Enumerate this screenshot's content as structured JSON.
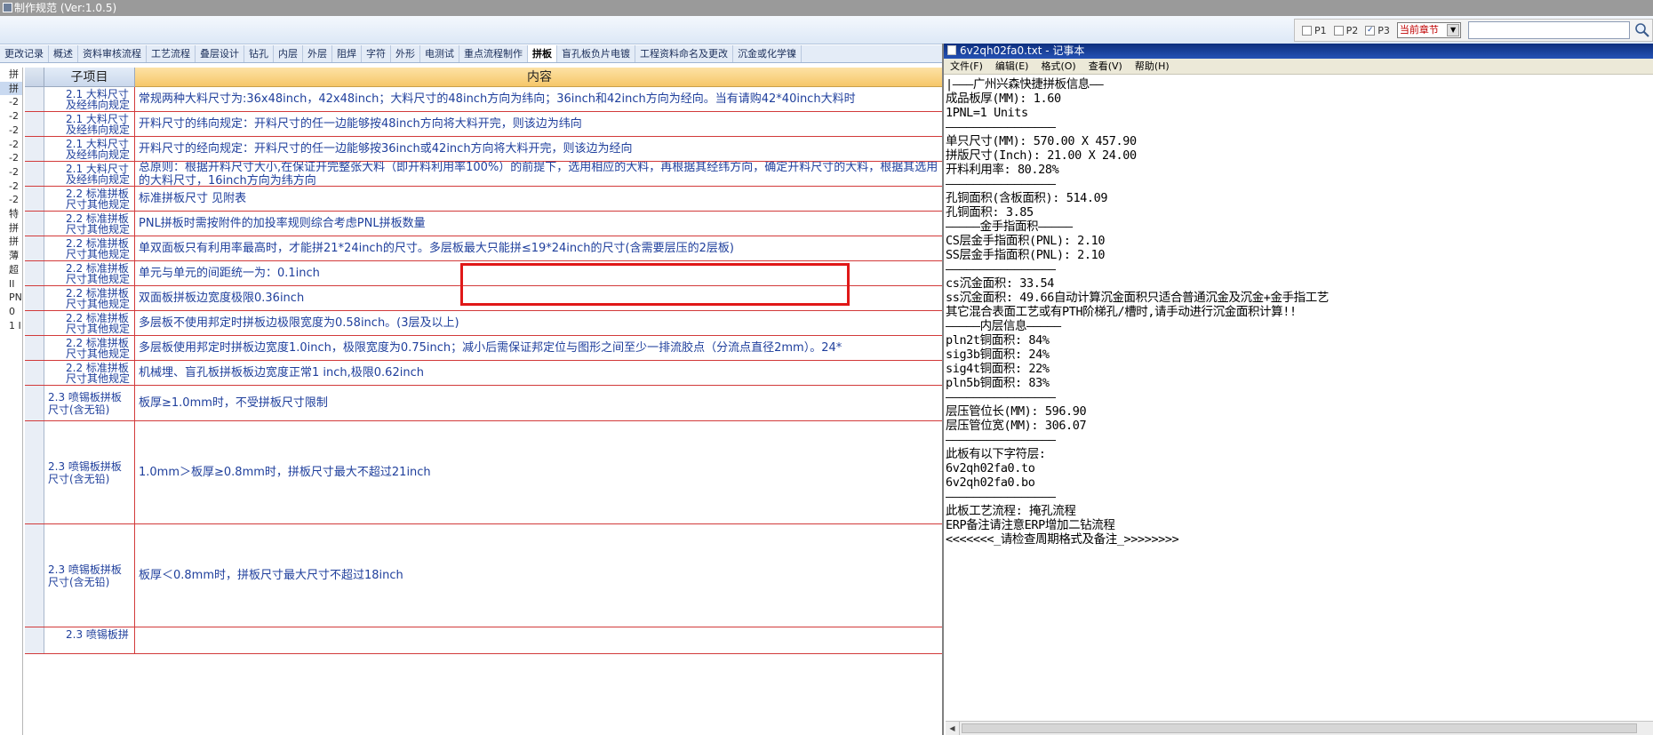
{
  "app": {
    "title": "制作规范 (Ver:1.0.5)"
  },
  "toolbar": {
    "pages": [
      {
        "label": "P1",
        "checked": false
      },
      {
        "label": "P2",
        "checked": false
      },
      {
        "label": "P3",
        "checked": true
      }
    ],
    "chapter_value": "当前章节",
    "search_value": ""
  },
  "tabs": [
    {
      "label": "更改记录",
      "active": false
    },
    {
      "label": "概述",
      "active": false
    },
    {
      "label": "资料审核流程",
      "active": false
    },
    {
      "label": "工艺流程",
      "active": false
    },
    {
      "label": "叠层设计",
      "active": false
    },
    {
      "label": "钻孔",
      "active": false
    },
    {
      "label": "内层",
      "active": false
    },
    {
      "label": "外层",
      "active": false
    },
    {
      "label": "阻焊",
      "active": false
    },
    {
      "label": "字符",
      "active": false
    },
    {
      "label": "外形",
      "active": false
    },
    {
      "label": "电测试",
      "active": false
    },
    {
      "label": "重点流程制作",
      "active": false
    },
    {
      "label": "拼板",
      "active": true
    },
    {
      "label": "盲孔板负片电镀",
      "active": false
    },
    {
      "label": "工程资料命名及更改",
      "active": false
    },
    {
      "label": "沉金或化学镍",
      "active": false
    }
  ],
  "left_tree": [
    "拼",
    "拼",
    "-2",
    "-2",
    "-2",
    "-2",
    "-2",
    "-2",
    "-2",
    "-2",
    "特",
    "拼",
    "拼",
    "薄",
    "超",
    "II",
    "PN",
    "0 ",
    "1 I"
  ],
  "grid": {
    "headers": {
      "sub": "子项目",
      "content": "内容"
    },
    "rows": [
      {
        "sub": "2.1 大料尺寸及经纬向规定",
        "content": "常规两种大料尺寸为:36x48inch，42x48inch；大料尺寸的48inch方向为纬向；36inch和42inch方向为经向。当有请购42*40inch大料时",
        "h": 28
      },
      {
        "sub": "2.1 大料尺寸及经纬向规定",
        "content": "开料尺寸的纬向规定：开料尺寸的任一边能够按48inch方向将大料开完，则该边为纬向",
        "h": 28
      },
      {
        "sub": "2.1 大料尺寸及经纬向规定",
        "content": "开料尺寸的经向规定：开料尺寸的任一边能够按36inch或42inch方向将大料开完，则该边为经向",
        "h": 28
      },
      {
        "sub": "2.1 大料尺寸及经纬向规定",
        "content": "总原则：根据开料尺寸大小,在保证开完整张大料（即开料利用率100%）的前提下，选用相应的大料，再根据其经纬方向，确定开料尺寸的大料，根据其选用的大料尺寸，16inch方向为纬方向",
        "h": 28,
        "wrap": true
      },
      {
        "sub": "2.2 标准拼板尺寸其他规定",
        "content": "标准拼板尺寸 见附表",
        "h": 28
      },
      {
        "sub": "2.2 标准拼板尺寸其他规定",
        "content": "PNL拼板时需按附件的加投率规则综合考虑PNL拼板数量",
        "h": 28
      },
      {
        "sub": "2.2 标准拼板尺寸其他规定",
        "content": "单双面板只有利用率最高时，才能拼21*24inch的尺寸。多层板最大只能拼≤19*24inch的尺寸(含需要层压的2层板)",
        "h": 28
      },
      {
        "sub": "2.2 标准拼板尺寸其他规定",
        "content": "单元与单元的间距统一为：0.1inch",
        "h": 28
      },
      {
        "sub": "2.2 标准拼板尺寸其他规定",
        "content": "双面板拼板边宽度极限0.36inch",
        "h": 28
      },
      {
        "sub": "2.2 标准拼板尺寸其他规定",
        "content": "多层板不使用邦定时拼板边极限宽度为0.58inch。(3层及以上)",
        "h": 28
      },
      {
        "sub": "2.2 标准拼板尺寸其他规定",
        "content": "多层板使用邦定时拼板边宽度1.0inch，极限宽度为0.75inch；减小后需保证邦定位与图形之间至少一排流胶点（分流点直径2mm）。24*",
        "h": 28
      },
      {
        "sub": "2.2 标准拼板尺寸其他规定",
        "content": "机械埋、盲孔板拼板板边宽度正常1 inch,极限0.62inch",
        "h": 28
      },
      {
        "sub": "2.3 喷锡板拼板尺寸(含无铅)",
        "content": "板厚≥1.0mm时，不受拼板尺寸限制",
        "h": 40
      },
      {
        "sub": "2.3 喷锡板拼板尺寸(含无铅)",
        "content": "1.0mm＞板厚≥0.8mm时，拼板尺寸最大不超过21inch",
        "h": 116
      },
      {
        "sub": "2.3 喷锡板拼板尺寸(含无铅)",
        "content": "板厚＜0.8mm时，拼板尺寸最大尺寸不超过18inch",
        "h": 116
      },
      {
        "sub": "2.3 喷锡板拼",
        "content": "",
        "h": 30
      }
    ]
  },
  "notepad": {
    "title": "6v2qh02fa0.txt - 记事本",
    "menu": [
      "文件(F)",
      "编辑(E)",
      "格式(O)",
      "查看(V)",
      "帮助(H)"
    ],
    "lines": [
      "|———广州兴森快捷拼板信息——",
      "成品板厚(MM): 1.60",
      "1PNL=1 Units",
      "————————————————",
      "单只尺寸(MM): 570.00 X 457.90",
      "拼版尺寸(Inch): 21.00 X 24.00",
      "开料利用率: 80.28%",
      "————————————————",
      "孔铜面积(含板面积): 514.09",
      "孔铜面积: 3.85",
      "—————金手指面积—————",
      "CS层金手指面积(PNL): 2.10",
      "SS层金手指面积(PNL): 2.10",
      "————————————————",
      "cs沉金面积: 33.54",
      "ss沉金面积: 49.66自动计算沉金面积只适合普通沉金及沉金+金手指工艺",
      "其它混合表面工艺或有PTH阶梯孔/槽时,请手动进行沉金面积计算!!",
      "—————内层信息—————",
      "pln2t铜面积: 84%",
      "sig3b铜面积: 24%",
      "sig4t铜面积: 22%",
      "pln5b铜面积: 83%",
      "————————————————",
      "层压管位长(MM): 596.90",
      "层压管位宽(MM): 306.07",
      "————————————————",
      "此板有以下字符层:",
      "6v2qh02fa0.to",
      "6v2qh02fa0.bo",
      "————————————————",
      "此板工艺流程: 掩孔流程",
      "ERP备注请注意ERP增加二钻流程",
      "<<<<<<<_请检查周期格式及备注_>>>>>>>>"
    ]
  },
  "colors": {
    "content_text": "#1f3f9c",
    "row_border": "#d23a3a",
    "header_content_bg": "#f6c769",
    "notepad_title_bg": "#0d2f7e",
    "highlight_border": "#e01818"
  }
}
